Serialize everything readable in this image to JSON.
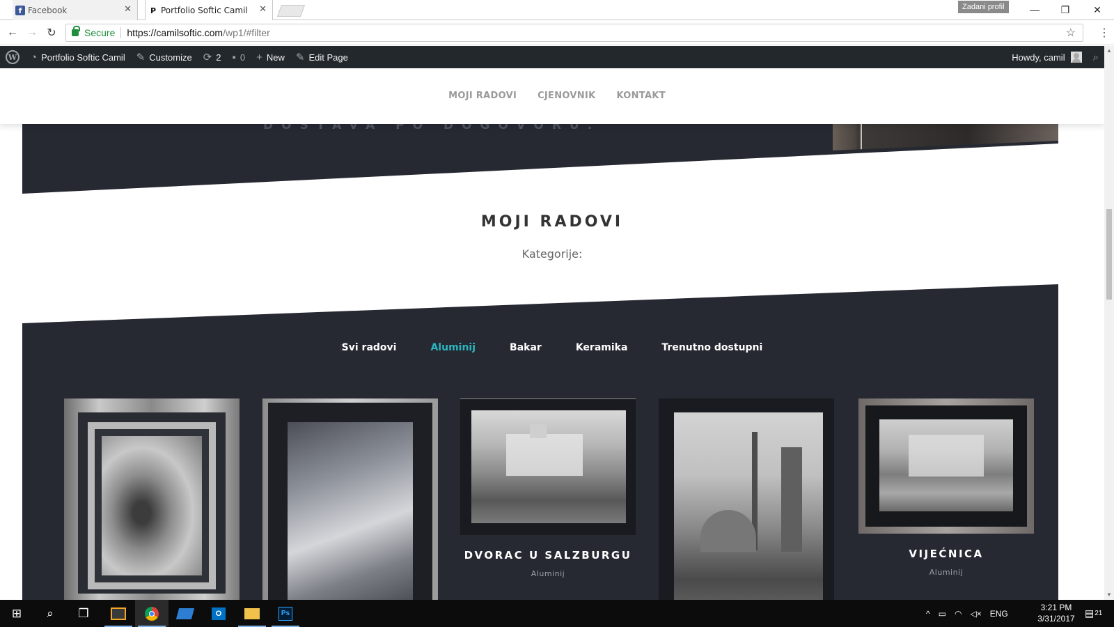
{
  "browser": {
    "tabs": [
      {
        "title": "Facebook",
        "favicon": "facebook-icon",
        "active": false
      },
      {
        "title": "Portfolio Softic Camil",
        "favicon": "p-icon",
        "active": true
      }
    ],
    "profile_label": "Zadani profil",
    "address": {
      "secure_label": "Secure",
      "url_base": "https://camilsoftic.com",
      "url_rest": "/wp1/#filter"
    }
  },
  "adminbar": {
    "site_name": "Portfolio Softic Camil",
    "customize": "Customize",
    "updates_count": "2",
    "comments_count": "0",
    "new_label": "New",
    "edit_label": "Edit Page",
    "howdy": "Howdy, camil"
  },
  "site": {
    "nav": [
      "MOJI RADOVI",
      "CJENOVNIK",
      "KONTAKT"
    ],
    "hero_text": "DOSTAVA PO DOGOVORU.",
    "section_title": "MOJI RADOVI",
    "section_subtitle": "Kategorije:",
    "filters": [
      {
        "label": "Svi radovi",
        "active": false
      },
      {
        "label": "Aluminij",
        "active": true
      },
      {
        "label": "Bakar",
        "active": false
      },
      {
        "label": "Keramika",
        "active": false
      },
      {
        "label": "Trenutno dostupni",
        "active": false
      }
    ],
    "portfolio": [
      {
        "title": "",
        "category": ""
      },
      {
        "title": "",
        "category": ""
      },
      {
        "title": "DVORAC U SALZBURGU",
        "category": "Aluminij"
      },
      {
        "title": "",
        "category": ""
      },
      {
        "title": "VIJEĆNICA",
        "category": "Aluminij"
      }
    ]
  },
  "taskbar": {
    "language": "ENG",
    "time": "3:21 PM",
    "date": "3/31/2017",
    "notifications": "21"
  },
  "colors": {
    "accent": "#2bb5bf",
    "dark_band": "#262932",
    "admin_bar": "#23282d"
  }
}
